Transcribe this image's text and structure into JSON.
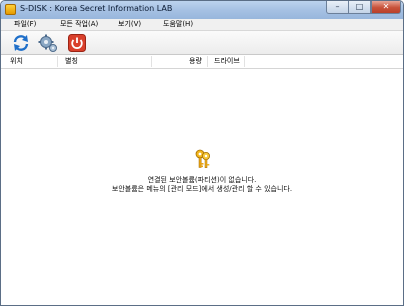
{
  "window": {
    "title": "S-DISK : Korea Secret Information LAB",
    "controls": {
      "minimize": "–",
      "maximize": "□",
      "close": "✕"
    }
  },
  "menu": {
    "items": [
      {
        "label": "파일(F)"
      },
      {
        "label": "모든 작업(A)"
      },
      {
        "label": "보기(V)"
      },
      {
        "label": "도움말(H)"
      }
    ]
  },
  "toolbar": {
    "buttons": [
      {
        "icon": "refresh-icon"
      },
      {
        "icon": "settings-icon"
      },
      {
        "icon": "power-icon"
      }
    ]
  },
  "columns": [
    {
      "label": "위치"
    },
    {
      "label": "별칭"
    },
    {
      "label": "용량"
    },
    {
      "label": "드라이브"
    }
  ],
  "empty_state": {
    "icon": "keys-icon",
    "line1": "연결된 보안볼륨(파티션)이 없습니다.",
    "line2": "보안볼륨은 메뉴의 [관리 모드]에서 생성/관리 할 수 있습니다."
  }
}
